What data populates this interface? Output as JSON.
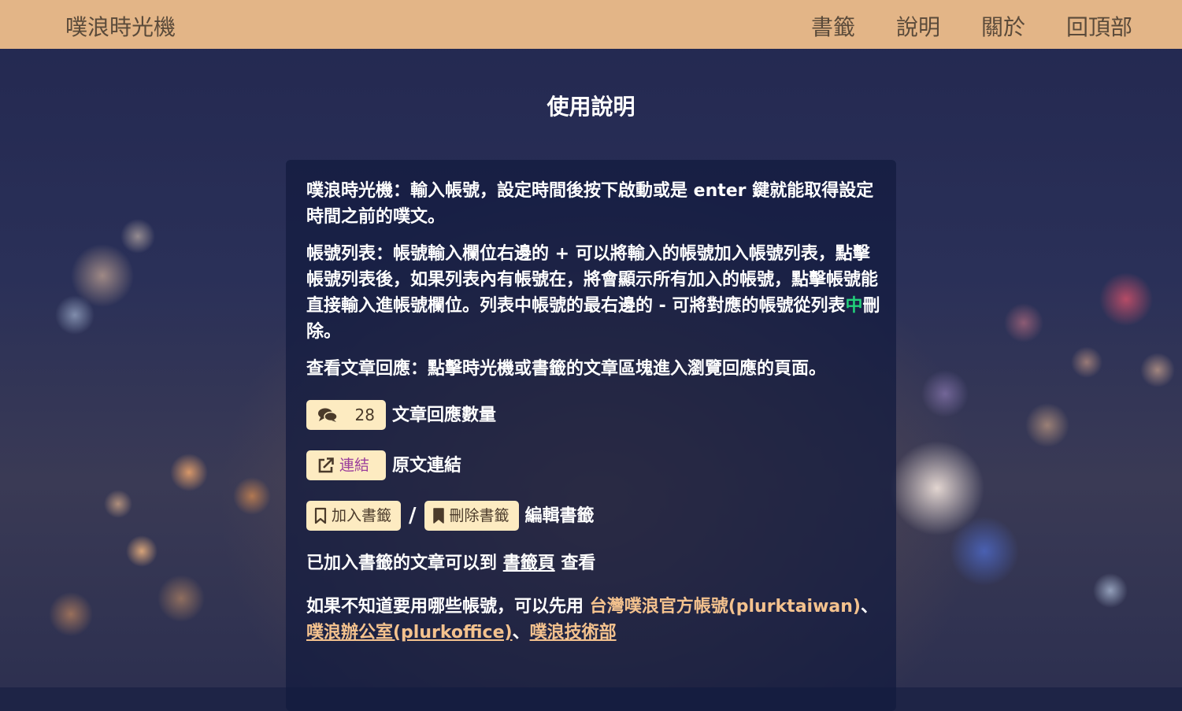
{
  "navbar": {
    "brand": "噗浪時光機",
    "links": [
      "書籤",
      "說明",
      "關於",
      "回頂部"
    ]
  },
  "page": {
    "title": "使用說明"
  },
  "help": {
    "p1": "噗浪時光機：輸入帳號，設定時間後按下啟動或是 enter 鍵就能取得設定時間之前的噗文。",
    "p2_before": "帳號列表：帳號輸入欄位右邊的 + 可以將輸入的帳號加入帳號列表，點擊帳號列表後，如果列表內有帳號在，將會顯示所有加入的帳號，點擊帳號能直接輸入進帳號欄位。列表中帳號的最右邊的 - 可將對應的帳號從列表",
    "p2_highlight": "中",
    "p2_after": "刪除。",
    "p3": "查看文章回應：點擊時光機或書籤的文章區塊進入瀏覽回應的頁面。",
    "reply_count": "28",
    "reply_count_desc": "文章回應數量",
    "link_label": "連結",
    "link_desc": "原文連結",
    "add_bookmark": "加入書籤",
    "slash": "/",
    "remove_bookmark": "刪除書籤",
    "bookmark_desc": "編輯書籤",
    "bookmark_page_before": "已加入書籤的文章可以到",
    "bookmark_page_link": "書籤頁",
    "bookmark_page_after": "查看",
    "suggest_before": "如果不知道要用哪些帳號，可以先用",
    "suggest_link1": "台灣噗浪官方帳號(plurktaiwan)",
    "suggest_sep1": "、",
    "suggest_link2": "噗浪辦公室(plurkoffice)",
    "suggest_sep2": "、",
    "suggest_link3": "噗浪技術部"
  },
  "colors": {
    "navbar": "#e3b587",
    "badge": "#fdebc1",
    "link_orange": "#f4c28e",
    "highlight_green": "#22d07a"
  },
  "icons": {
    "reply": "comments-icon",
    "link": "external-link-icon",
    "add_bookmark": "bookmark-outline-icon",
    "remove_bookmark": "bookmark-filled-icon"
  }
}
